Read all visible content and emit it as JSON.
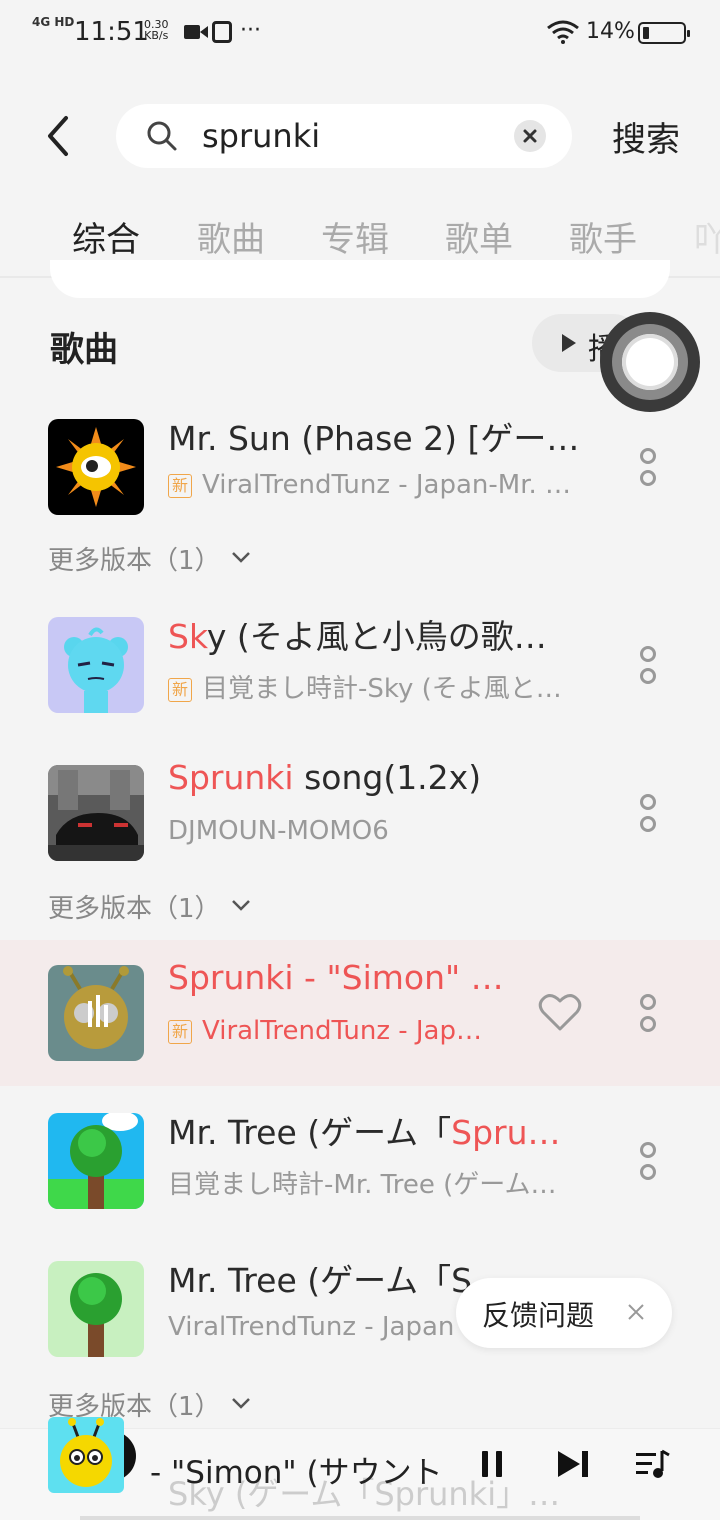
{
  "status_bar": {
    "network": "4G HD",
    "time": "11:51",
    "speed_value": "0.30",
    "speed_unit": "KB/s",
    "more": "···",
    "battery_percent": "14%",
    "battery_level": 0.14
  },
  "search": {
    "query": "sprunki",
    "submit_label": "搜索"
  },
  "tabs": [
    {
      "label": "综合",
      "active": true
    },
    {
      "label": "歌曲",
      "active": false
    },
    {
      "label": "专辑",
      "active": false
    },
    {
      "label": "歌单",
      "active": false
    },
    {
      "label": "歌手",
      "active": false
    },
    {
      "label": "吖",
      "active": false
    }
  ],
  "section": {
    "title": "歌曲",
    "play_all_label": "播"
  },
  "songs": [
    {
      "title": "Mr. Sun (Phase 2) [ゲー…",
      "title_highlight": "",
      "subtitle": "ViralTrendTunz - Japan-Mr. …",
      "badge": "新",
      "more_versions": "更多版本（1）"
    },
    {
      "title_highlight": "Sk",
      "title": "y (そよ風と小鳥の歌…",
      "subtitle": "目覚まし時計-Sky (そよ風と…",
      "badge": "新"
    },
    {
      "title_highlight": "Sprunki",
      "title": " song(1.2x)",
      "subtitle": "DJMOUN-MOMO6",
      "more_versions": "更多版本（1）"
    },
    {
      "title_highlight": "Sprunki - \"Simon\" …",
      "title": "",
      "subtitle": "ViralTrendTunz - Jap…",
      "badge": "新",
      "playing": true
    },
    {
      "title": "Mr. Tree (ゲーム「",
      "title_highlight": "Spru…",
      "subtitle": "目覚まし時計-Mr. Tree (ゲーム…"
    },
    {
      "title": "Mr. Tree (ゲーム「S",
      "subtitle": "ViralTrendTunz - Japan",
      "more_versions": "更多版本（1）"
    }
  ],
  "feedback": {
    "label": "反馈问题",
    "close": "×"
  },
  "player": {
    "now_playing": " - \"Simon\" (サウント",
    "behind_text": "Sky (ゲーム「Sprunki」…"
  },
  "colors": {
    "accent": "#ee5555",
    "badge": "#f0a64a",
    "playing_row_bg": "#f4ebeb"
  },
  "icons": [
    "back-arrow-icon",
    "search-icon",
    "clear-icon",
    "play-icon",
    "more-vertical-icon",
    "heart-icon",
    "chevron-down-icon",
    "close-icon",
    "pause-icon",
    "next-icon",
    "playlist-icon",
    "wifi-icon",
    "battery-icon",
    "video-camera-icon",
    "sim-card-icon"
  ]
}
